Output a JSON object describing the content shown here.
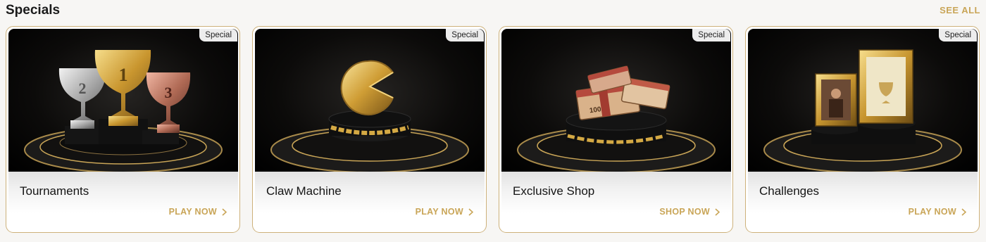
{
  "section": {
    "title": "Specials",
    "see_all": "SEE ALL"
  },
  "cards": [
    {
      "title": "Tournaments",
      "badge": "Special",
      "action": "PLAY NOW",
      "icon": "trophy-podium-art"
    },
    {
      "title": "Claw Machine",
      "badge": "Special",
      "action": "PLAY NOW",
      "icon": "gold-coin-pacman-art"
    },
    {
      "title": "Exclusive Shop",
      "badge": "Special",
      "action": "SHOP NOW",
      "icon": "cash-bundle-art"
    },
    {
      "title": "Challenges",
      "badge": "Special",
      "action": "PLAY NOW",
      "icon": "framed-pictures-art"
    }
  ],
  "colors": {
    "accent": "#c9a557",
    "card_border": "#cdb17a",
    "background": "#f7f6f4"
  }
}
